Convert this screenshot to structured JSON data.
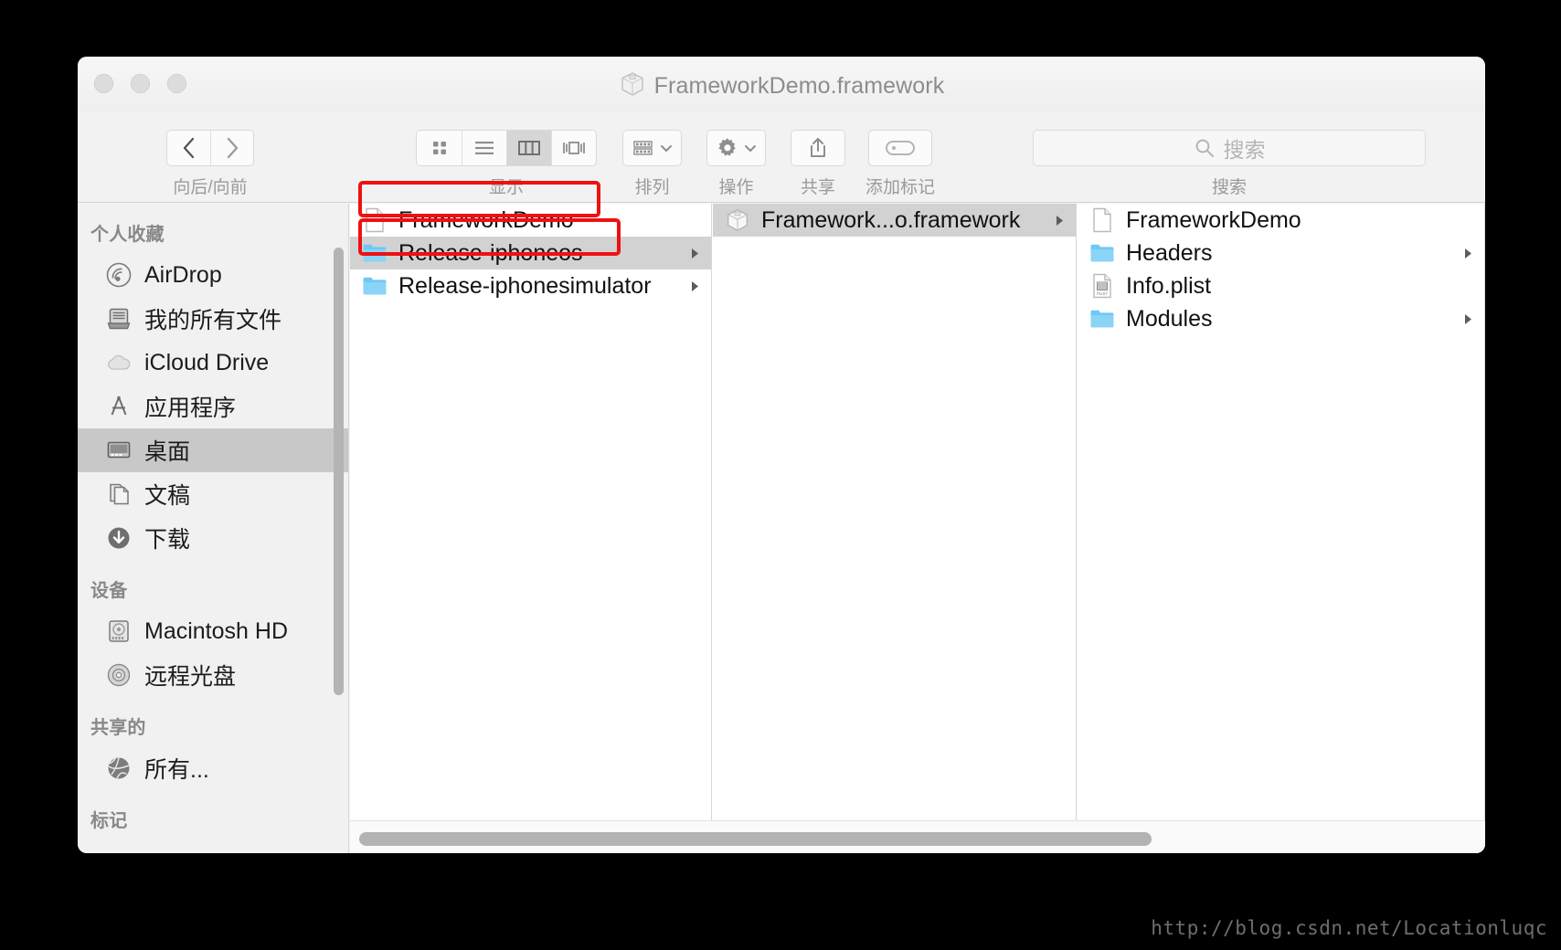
{
  "window": {
    "title": "FrameworkDemo.framework",
    "title_icon": "framework-package-icon",
    "traffic_lights": [
      "close-button",
      "minimize-button",
      "zoom-button"
    ]
  },
  "toolbar": {
    "nav": {
      "caption": "向后/向前",
      "back_label": "‹",
      "forward_label": "›"
    },
    "view": {
      "caption": "显示",
      "options": [
        {
          "name": "icon-view",
          "selected": false
        },
        {
          "name": "list-view",
          "selected": false
        },
        {
          "name": "column-view",
          "selected": true
        },
        {
          "name": "cover-flow-view",
          "selected": false
        }
      ]
    },
    "arrange": {
      "caption": "排列"
    },
    "action": {
      "caption": "操作"
    },
    "share": {
      "caption": "共享"
    },
    "tag": {
      "caption": "添加标记"
    },
    "search": {
      "caption": "搜索",
      "placeholder": "搜索",
      "value": ""
    }
  },
  "sidebar": {
    "sections": [
      {
        "title": "个人收藏",
        "items": [
          {
            "label": "AirDrop",
            "icon": "airdrop-icon",
            "selected": false
          },
          {
            "label": "我的所有文件",
            "icon": "all-my-files-icon",
            "selected": false
          },
          {
            "label": "iCloud Drive",
            "icon": "icloud-drive-icon",
            "selected": false
          },
          {
            "label": "应用程序",
            "icon": "applications-icon",
            "selected": false
          },
          {
            "label": "桌面",
            "icon": "desktop-icon",
            "selected": true
          },
          {
            "label": "文稿",
            "icon": "documents-icon",
            "selected": false
          },
          {
            "label": "下载",
            "icon": "downloads-icon",
            "selected": false
          }
        ]
      },
      {
        "title": "设备",
        "items": [
          {
            "label": "Macintosh HD",
            "icon": "hard-disk-icon",
            "selected": false
          },
          {
            "label": "远程光盘",
            "icon": "remote-disc-icon",
            "selected": false
          }
        ]
      },
      {
        "title": "共享的",
        "items": [
          {
            "label": "所有...",
            "icon": "network-globe-icon",
            "selected": false
          }
        ]
      },
      {
        "title": "标记",
        "items": []
      }
    ]
  },
  "columns": [
    {
      "name": "column-1",
      "rows": [
        {
          "label": "FrameworkDemo",
          "icon": "document-icon",
          "selected": false,
          "has_children": false
        },
        {
          "label": "Release-iphoneos",
          "icon": "folder-icon",
          "selected": true,
          "has_children": true
        },
        {
          "label": "Release-iphonesimulator",
          "icon": "folder-icon",
          "selected": false,
          "has_children": true
        }
      ]
    },
    {
      "name": "column-2",
      "rows": [
        {
          "label": "Framework...o.framework",
          "icon": "framework-package-icon",
          "selected": true,
          "has_children": true
        }
      ]
    },
    {
      "name": "column-3",
      "rows": [
        {
          "label": "FrameworkDemo",
          "icon": "document-icon",
          "selected": false,
          "has_children": false
        },
        {
          "label": "Headers",
          "icon": "folder-icon",
          "selected": false,
          "has_children": true
        },
        {
          "label": "Info.plist",
          "icon": "plist-file-icon",
          "selected": false,
          "has_children": false
        },
        {
          "label": "Modules",
          "icon": "folder-icon",
          "selected": false,
          "has_children": true
        }
      ]
    }
  ],
  "annotations": {
    "color": "#ee1111",
    "boxes": [
      {
        "name": "highlight-frameworkdemo-binary"
      },
      {
        "name": "highlight-release-iphoneos"
      }
    ]
  },
  "watermark": {
    "text": "http://blog.csdn.net/Locationluqc"
  }
}
